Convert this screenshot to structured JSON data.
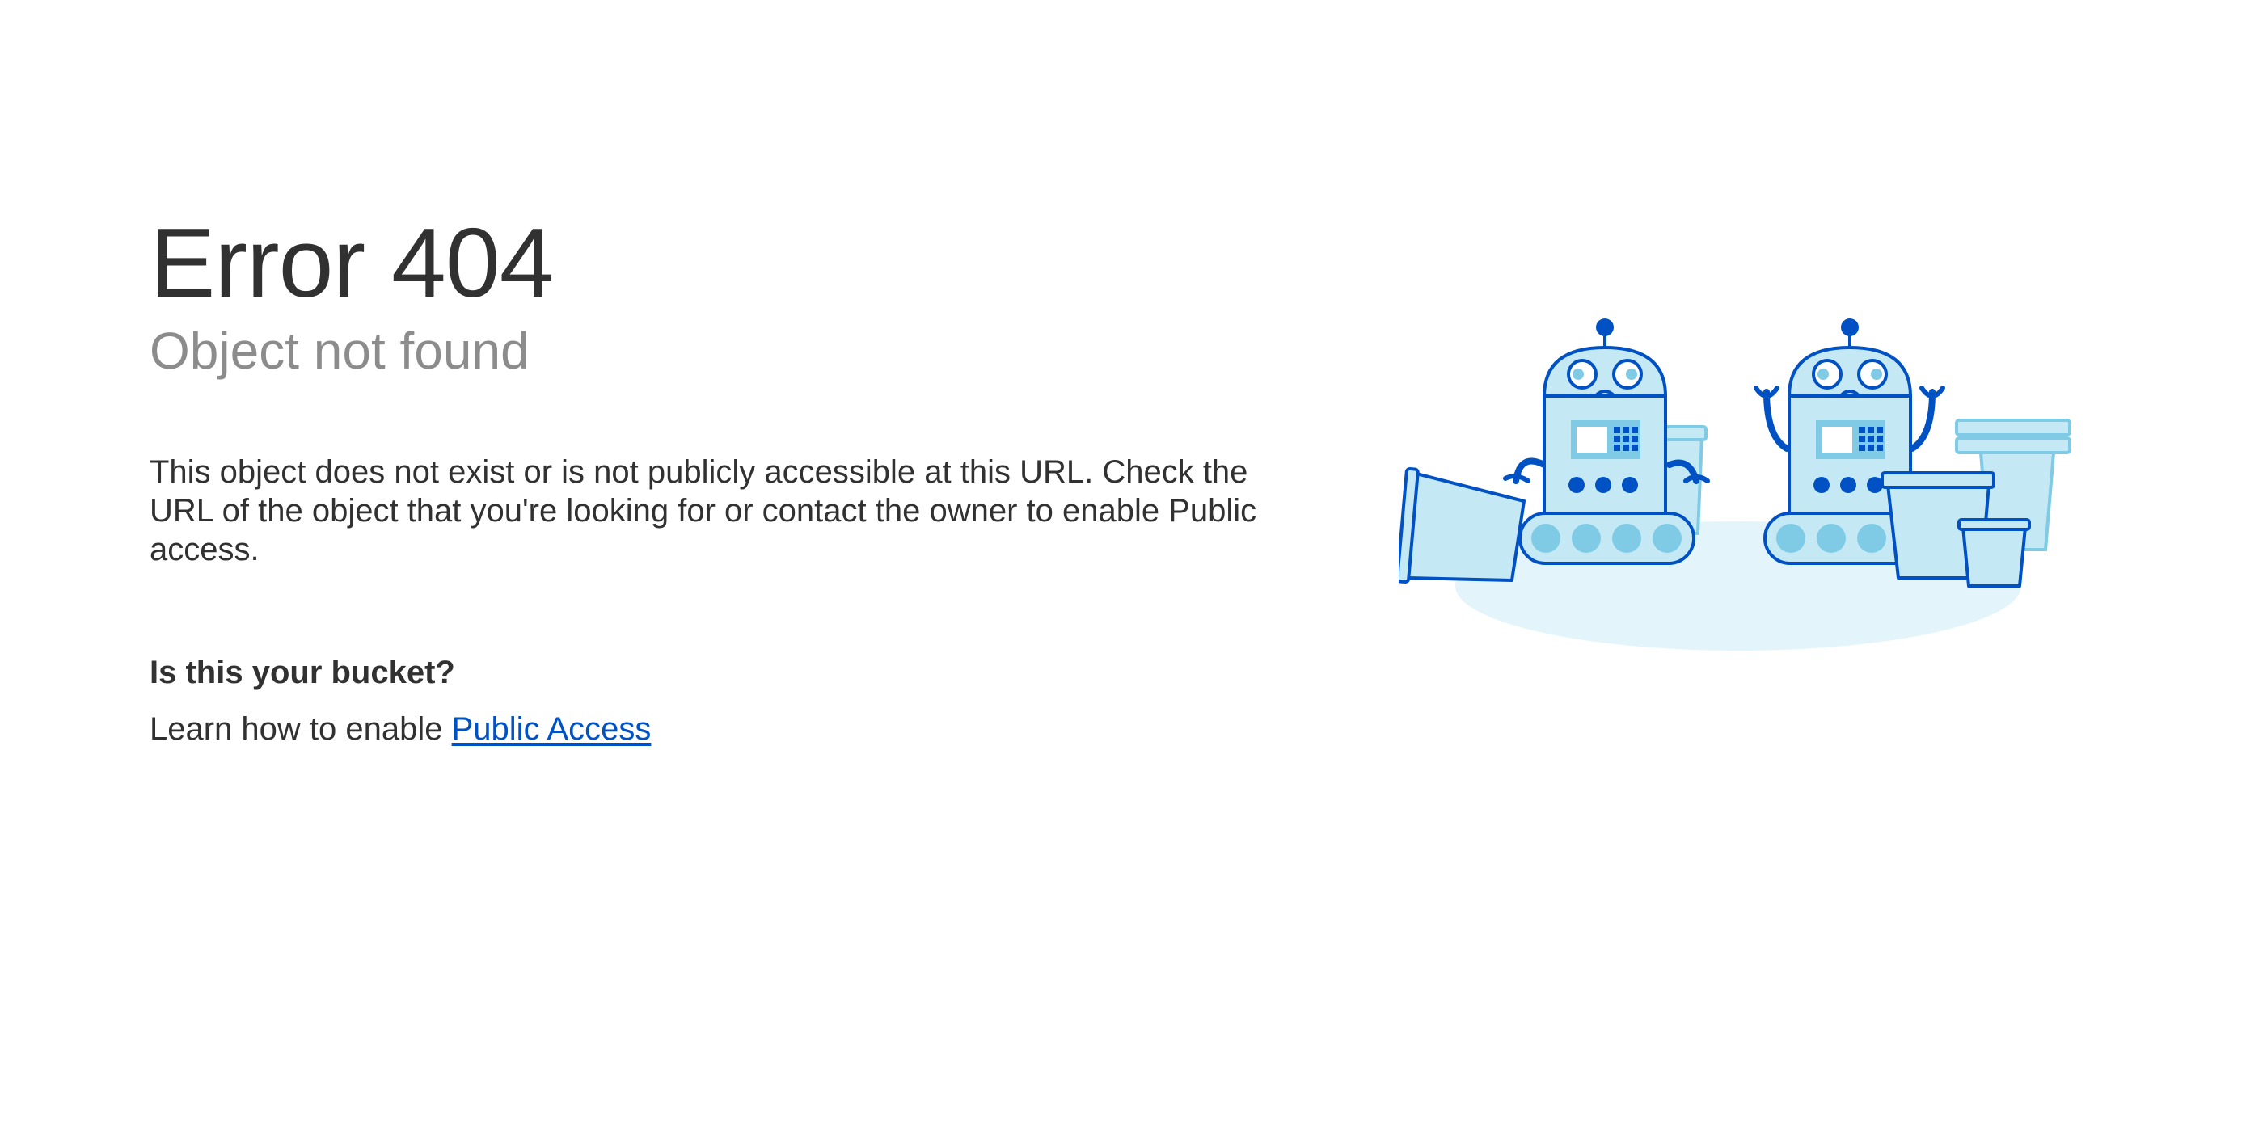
{
  "error": {
    "title": "Error 404",
    "subtitle": "Object not found",
    "description": "This object does not exist or is not publicly accessible at this URL. Check the URL of the object that you're looking for or contact the owner to enable Public access."
  },
  "bucket": {
    "heading": "Is this your bucket?",
    "learn_prefix": "Learn how to enable ",
    "link_label": "Public Access"
  },
  "colors": {
    "text": "#313131",
    "muted": "#8c8c8c",
    "link": "#0051c3",
    "robot_stroke": "#0051c3",
    "robot_fill": "#c5e8f5",
    "floor": "#e3f5fb"
  },
  "illustration": {
    "icon": "sad-robots-illustration"
  }
}
